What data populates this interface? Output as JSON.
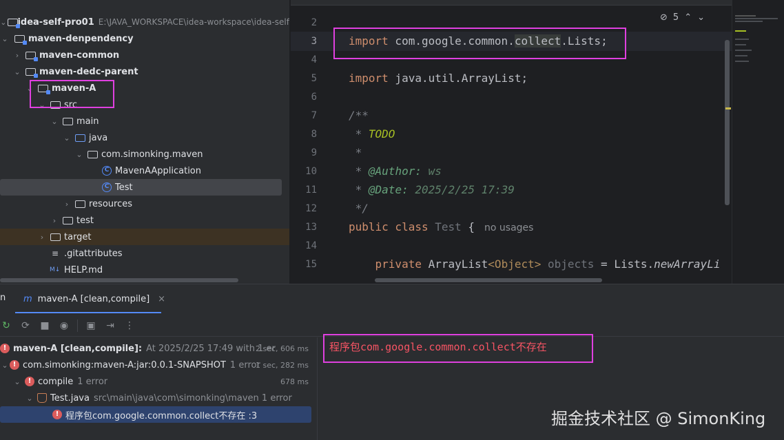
{
  "project_tree": {
    "root": {
      "label": "idea-self-pro01",
      "path": "E:\\JAVA_WORKSPACE\\idea-workspace\\idea-self"
    },
    "items": [
      {
        "label": "maven-denpendency"
      },
      {
        "label": "maven-common"
      },
      {
        "label": "maven-dedc-parent"
      },
      {
        "label": "maven-A"
      },
      {
        "label": "src"
      },
      {
        "label": "main"
      },
      {
        "label": "java"
      },
      {
        "label": "com.simonking.maven"
      },
      {
        "label": "MavenAApplication"
      },
      {
        "label": "Test"
      },
      {
        "label": "resources"
      },
      {
        "label": "test"
      },
      {
        "label": "target"
      },
      {
        "label": ".gitattributes"
      },
      {
        "label": "HELP.md"
      }
    ]
  },
  "editor": {
    "inspection_count": "5",
    "line_numbers": [
      "2",
      "3",
      "4",
      "5",
      "6",
      "7",
      "8",
      "9",
      "10",
      "11",
      "12",
      "13",
      "14",
      "15"
    ],
    "lines": {
      "l3_kw": "import",
      "l3_a": " com.google.common.",
      "l3_hl": "collect",
      "l3_b": ".Lists;",
      "l5_kw": "import",
      "l5_rest": " java.util.ArrayList;",
      "l7": "/**",
      "l8_pre": " * ",
      "l8_todo": "TODO",
      "l9": " *",
      "l10_pre": " * ",
      "l10_tag": "@Author:",
      "l10_val": " ws",
      "l11_pre": " * ",
      "l11_tag": "@Date:",
      "l11_val": " 2025/2/25 17:39",
      "l12": " */",
      "l13_kw": "public class",
      "l13_name": " Test",
      "l13_brace": " {",
      "l13_hint": "no usages",
      "l15_kw": "    private",
      "l15_type": " ArrayList",
      "l15_gen": "<Object>",
      "l15_field": " objects",
      "l15_eq": " = Lists.",
      "l15_mth": "newArrayLi"
    }
  },
  "run_panel": {
    "left_label": "n",
    "tab_label": "maven-A [clean,compile]",
    "results": [
      {
        "label": "maven-A [clean,compile]:",
        "muted": "At 2025/2/25 17:49 with 1 er",
        "time": "2 sec, 606 ms"
      },
      {
        "label": "com.simonking:maven-A:jar:0.0.1-SNAPSHOT",
        "muted": "1 error",
        "time": "1 sec, 282 ms"
      },
      {
        "label": "compile",
        "muted": "1 error",
        "time": "678 ms"
      },
      {
        "label": "Test.java",
        "muted": "src\\main\\java\\com\\simonking\\maven 1 error",
        "time": ""
      },
      {
        "label": "程序包com.google.common.collect不存在 :3",
        "muted": "",
        "time": ""
      }
    ],
    "console_message": "程序包com.google.common.collect不存在"
  },
  "watermark": "掘金技术社区 @ SimonKing",
  "colors": {
    "annotation": "#e040e0",
    "error": "#db5c5c",
    "keyword": "#cf8e6d",
    "selection": "#2e436e"
  }
}
